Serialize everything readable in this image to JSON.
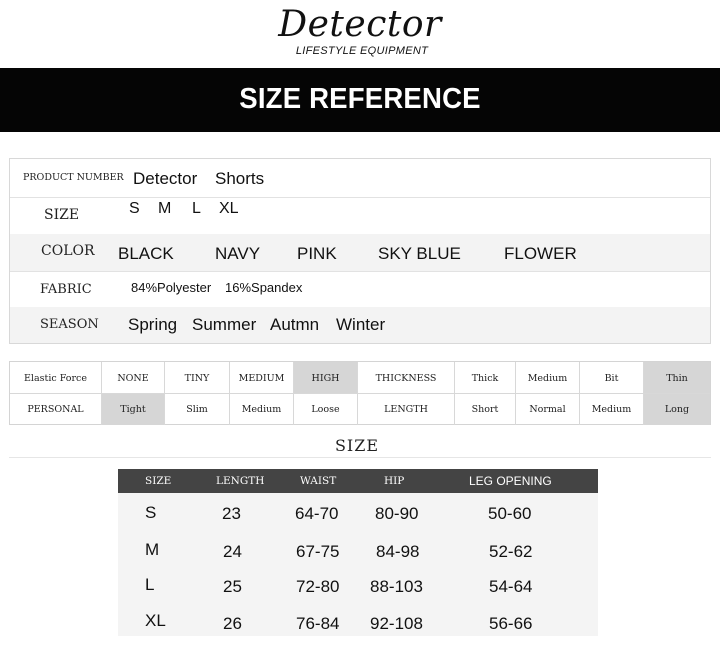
{
  "brand": {
    "name": "Detector",
    "tagline": "LIFESTYLE EQUIPMENT"
  },
  "banner": {
    "title": "SIZE REFERENCE"
  },
  "info": {
    "product_number": {
      "label": "PRODUCT NUMBER",
      "values": [
        "Detector",
        "Shorts"
      ]
    },
    "size": {
      "label": "SIZE",
      "values": [
        "S",
        "M",
        "L",
        "XL"
      ]
    },
    "color": {
      "label": "COLOR",
      "values": [
        "BLACK",
        "NAVY",
        "PINK",
        "SKY BLUE",
        "FLOWER"
      ]
    },
    "fabric": {
      "label": "FABRIC",
      "values": [
        "84%Polyester",
        "16%Spandex"
      ]
    },
    "season": {
      "label": "SEASON",
      "values": [
        "Spring",
        "Summer",
        "Autmn",
        "Winter"
      ]
    }
  },
  "attributes": {
    "row1": [
      "Elastic Force",
      "NONE",
      "TINY",
      "MEDIUM",
      "HIGH",
      "THICKNESS",
      "Thick",
      "Medium",
      "Bit",
      "Thin"
    ],
    "row2": [
      "PERSONAL",
      "Tight",
      "Slim",
      "Medium",
      "Loose",
      "LENGTH",
      "Short",
      "Normal",
      "Medium",
      "Long"
    ],
    "highlighted": {
      "row1": [
        4,
        9
      ],
      "row2": [
        1,
        9
      ]
    },
    "highlight_color": "#d6d6d6"
  },
  "size_caption": "SIZE",
  "size_chart": {
    "headers": [
      "SIZE",
      "LENGTH",
      "WAIST",
      "HIP",
      "LEG OPENING"
    ],
    "rows": [
      [
        "S",
        "23",
        "64-70",
        "80-90",
        "50-60"
      ],
      [
        "M",
        "24",
        "67-75",
        "84-98",
        "52-62"
      ],
      [
        "L",
        "25",
        "72-80",
        "88-103",
        "54-64"
      ],
      [
        "XL",
        "26",
        "76-84",
        "92-108",
        "56-66"
      ]
    ],
    "header_color": "#444444"
  }
}
